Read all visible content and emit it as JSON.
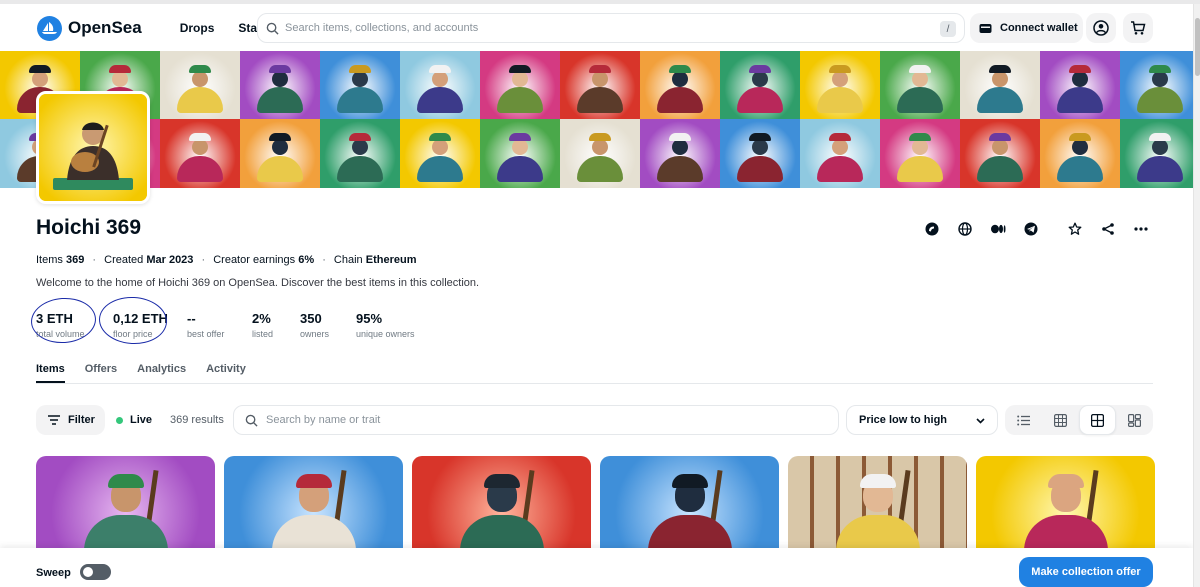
{
  "header": {
    "brand": "OpenSea",
    "nav": [
      "Drops",
      "Stats"
    ],
    "search_placeholder": "Search items, collections, and accounts",
    "search_shortcut": "/",
    "connect_label": "Connect wallet",
    "icons": [
      "wallet-icon",
      "profile-icon",
      "cart-icon"
    ]
  },
  "collection": {
    "name": "Hoichi 369",
    "meta": {
      "items_label": "Items",
      "items_value": "369",
      "created_label": "Created",
      "created_value": "Mar 2023",
      "earnings_label": "Creator earnings",
      "earnings_value": "6%",
      "chain_label": "Chain",
      "chain_value": "Ethereum"
    },
    "description": "Welcome to the home of Hoichi 369 on OpenSea. Discover the best items in this collection.",
    "stats": [
      {
        "value": "3 ETH",
        "label": "total volume"
      },
      {
        "value": "0,12 ETH",
        "label": "floor price"
      },
      {
        "value": "--",
        "label": "best offer"
      },
      {
        "value": "2%",
        "label": "listed"
      },
      {
        "value": "350",
        "label": "owners"
      },
      {
        "value": "95%",
        "label": "unique owners"
      }
    ],
    "actions": [
      "discord-icon",
      "globe-icon",
      "medium-icon",
      "telegram-icon",
      "star-icon",
      "share-icon",
      "more-icon"
    ]
  },
  "tabs": [
    "Items",
    "Offers",
    "Analytics",
    "Activity"
  ],
  "active_tab": "Items",
  "toolbar": {
    "filter_label": "Filter",
    "live_label": "Live",
    "results": "369 results",
    "search_placeholder": "Search by name or trait",
    "sort_value": "Price low to high",
    "views": [
      "list-view-icon",
      "grid-small-icon",
      "grid-medium-icon",
      "grid-large-icon"
    ],
    "active_view": "grid-medium-icon"
  },
  "bottom": {
    "sweep_label": "Sweep",
    "offer_label": "Make collection offer"
  },
  "colors": {
    "accent": "#2081e2",
    "live": "#34c77b",
    "annotation": "#1a2ba8"
  }
}
